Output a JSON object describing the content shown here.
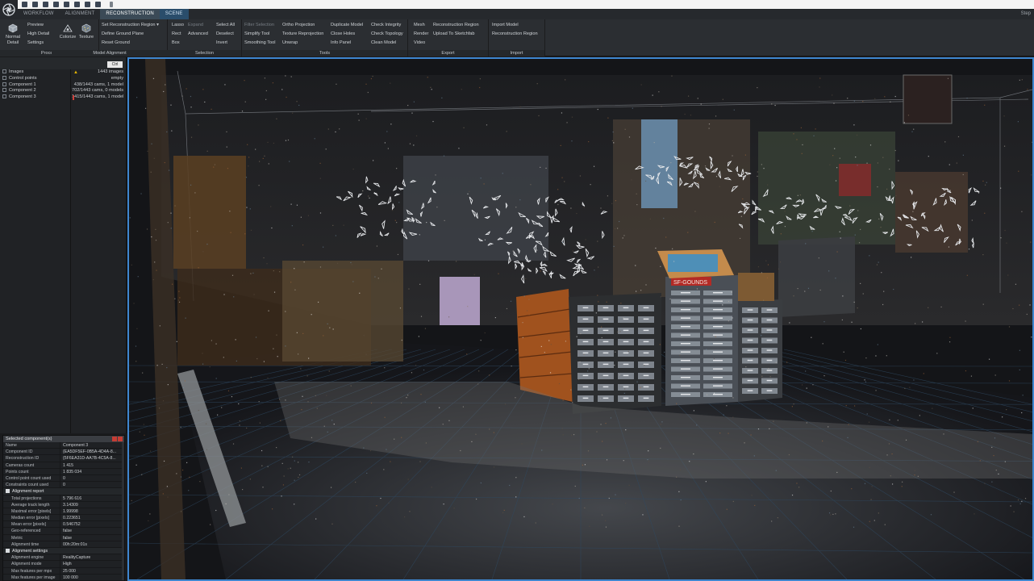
{
  "tabs": [
    "WORKFLOW",
    "ALIGNMENT",
    "RECONSTRUCTION",
    "SCENE"
  ],
  "active_tab": "RECONSTRUCTION",
  "top_right_text": "Step",
  "ribbon": {
    "process": {
      "title": "Process",
      "big_button": [
        "Normal",
        "Detail"
      ],
      "items": [
        "Preview",
        "High Detail",
        "Settings"
      ]
    },
    "model_alignment": {
      "title": "Model Alignment",
      "colorize": "Colorize",
      "texture": "Texture",
      "items": [
        "Set Reconstruction Region",
        "Define Ground Plane",
        "Reset Ground"
      ]
    },
    "selection": {
      "title": "Selection",
      "col1": [
        "Lasso",
        "Rect",
        "Box"
      ],
      "col2": [
        "Expand",
        "Advanced"
      ],
      "col3": [
        "Select All",
        "Deselect",
        "Invert"
      ]
    },
    "tools": {
      "title": "Tools",
      "col1": [
        "Filter Selection",
        "Simplify Tool",
        "Smoothing Tool"
      ],
      "col2": [
        "Ortho Projection",
        "Texture Reprojection",
        "Unwrap"
      ],
      "col3": [
        "Duplicate Model",
        "Close Holes",
        "Info Panel"
      ],
      "col4": [
        "Check Integrity",
        "Check Topology",
        "Clean Model"
      ]
    },
    "export": {
      "title": "Export",
      "col1": [
        "Mesh",
        "Render",
        "Video"
      ],
      "col2": [
        "Reconstruction Region",
        "Upload To Sketchfab"
      ]
    },
    "import": {
      "title": "Import",
      "col1": [
        "Import Model",
        "Reconstruction Region"
      ]
    }
  },
  "left_panel": {
    "expand_label": "Ctrl",
    "tree": [
      "Images",
      "Control points",
      "Component 1",
      "Component 2",
      "Component 3"
    ],
    "values": [
      "1443 images",
      "empty",
      "438/1443 cams, 1 model",
      "702/1443 cams, 0 models",
      "1415/1443 cams, 1 model"
    ]
  },
  "properties": {
    "title": "Selected component(s)",
    "rows": [
      [
        "Name",
        "Component 3"
      ],
      [
        "Component ID",
        "{EA5DF5EF-0B5A-4D4A-8..."
      ],
      [
        "Reconstruction ID",
        "{5F6EA31D-AA7B-4C5A-8..."
      ],
      [
        "Cameras count",
        "1 415"
      ],
      [
        "Points count",
        "1 835 034"
      ],
      [
        "Control point count used",
        "0"
      ],
      [
        "Constraints count used",
        "0"
      ]
    ],
    "alignment_report": {
      "title": "Alignment report",
      "rows": [
        [
          "Total projections",
          "5 796 616"
        ],
        [
          "Average track length",
          "3.14309"
        ],
        [
          "Maximal error [pixels]",
          "1.99998"
        ],
        [
          "Median error [pixels]",
          "0.223651"
        ],
        [
          "Mean error [pixels]",
          "0.546752"
        ],
        [
          "Geo-referenced",
          "false"
        ],
        [
          "Metric",
          "false"
        ],
        [
          "Alignment time",
          "00h:20m:01s"
        ]
      ]
    },
    "alignment_settings": {
      "title": "Alignment settings",
      "rows": [
        [
          "Alignment engine",
          "RealityCapture"
        ],
        [
          "Alignment mode",
          "High"
        ],
        [
          "Max features per mpx",
          "25 000"
        ],
        [
          "Max features per image",
          "100 000"
        ]
      ]
    }
  },
  "viewport": {
    "label_sign": "SF-GOUNDS"
  },
  "colors": {
    "accent_blue": "#3e86cf",
    "active_tab": "#3b4a57",
    "scene_tab": "#2a4d6b",
    "warning": "#e3b400",
    "close_red": "#c63c34"
  }
}
